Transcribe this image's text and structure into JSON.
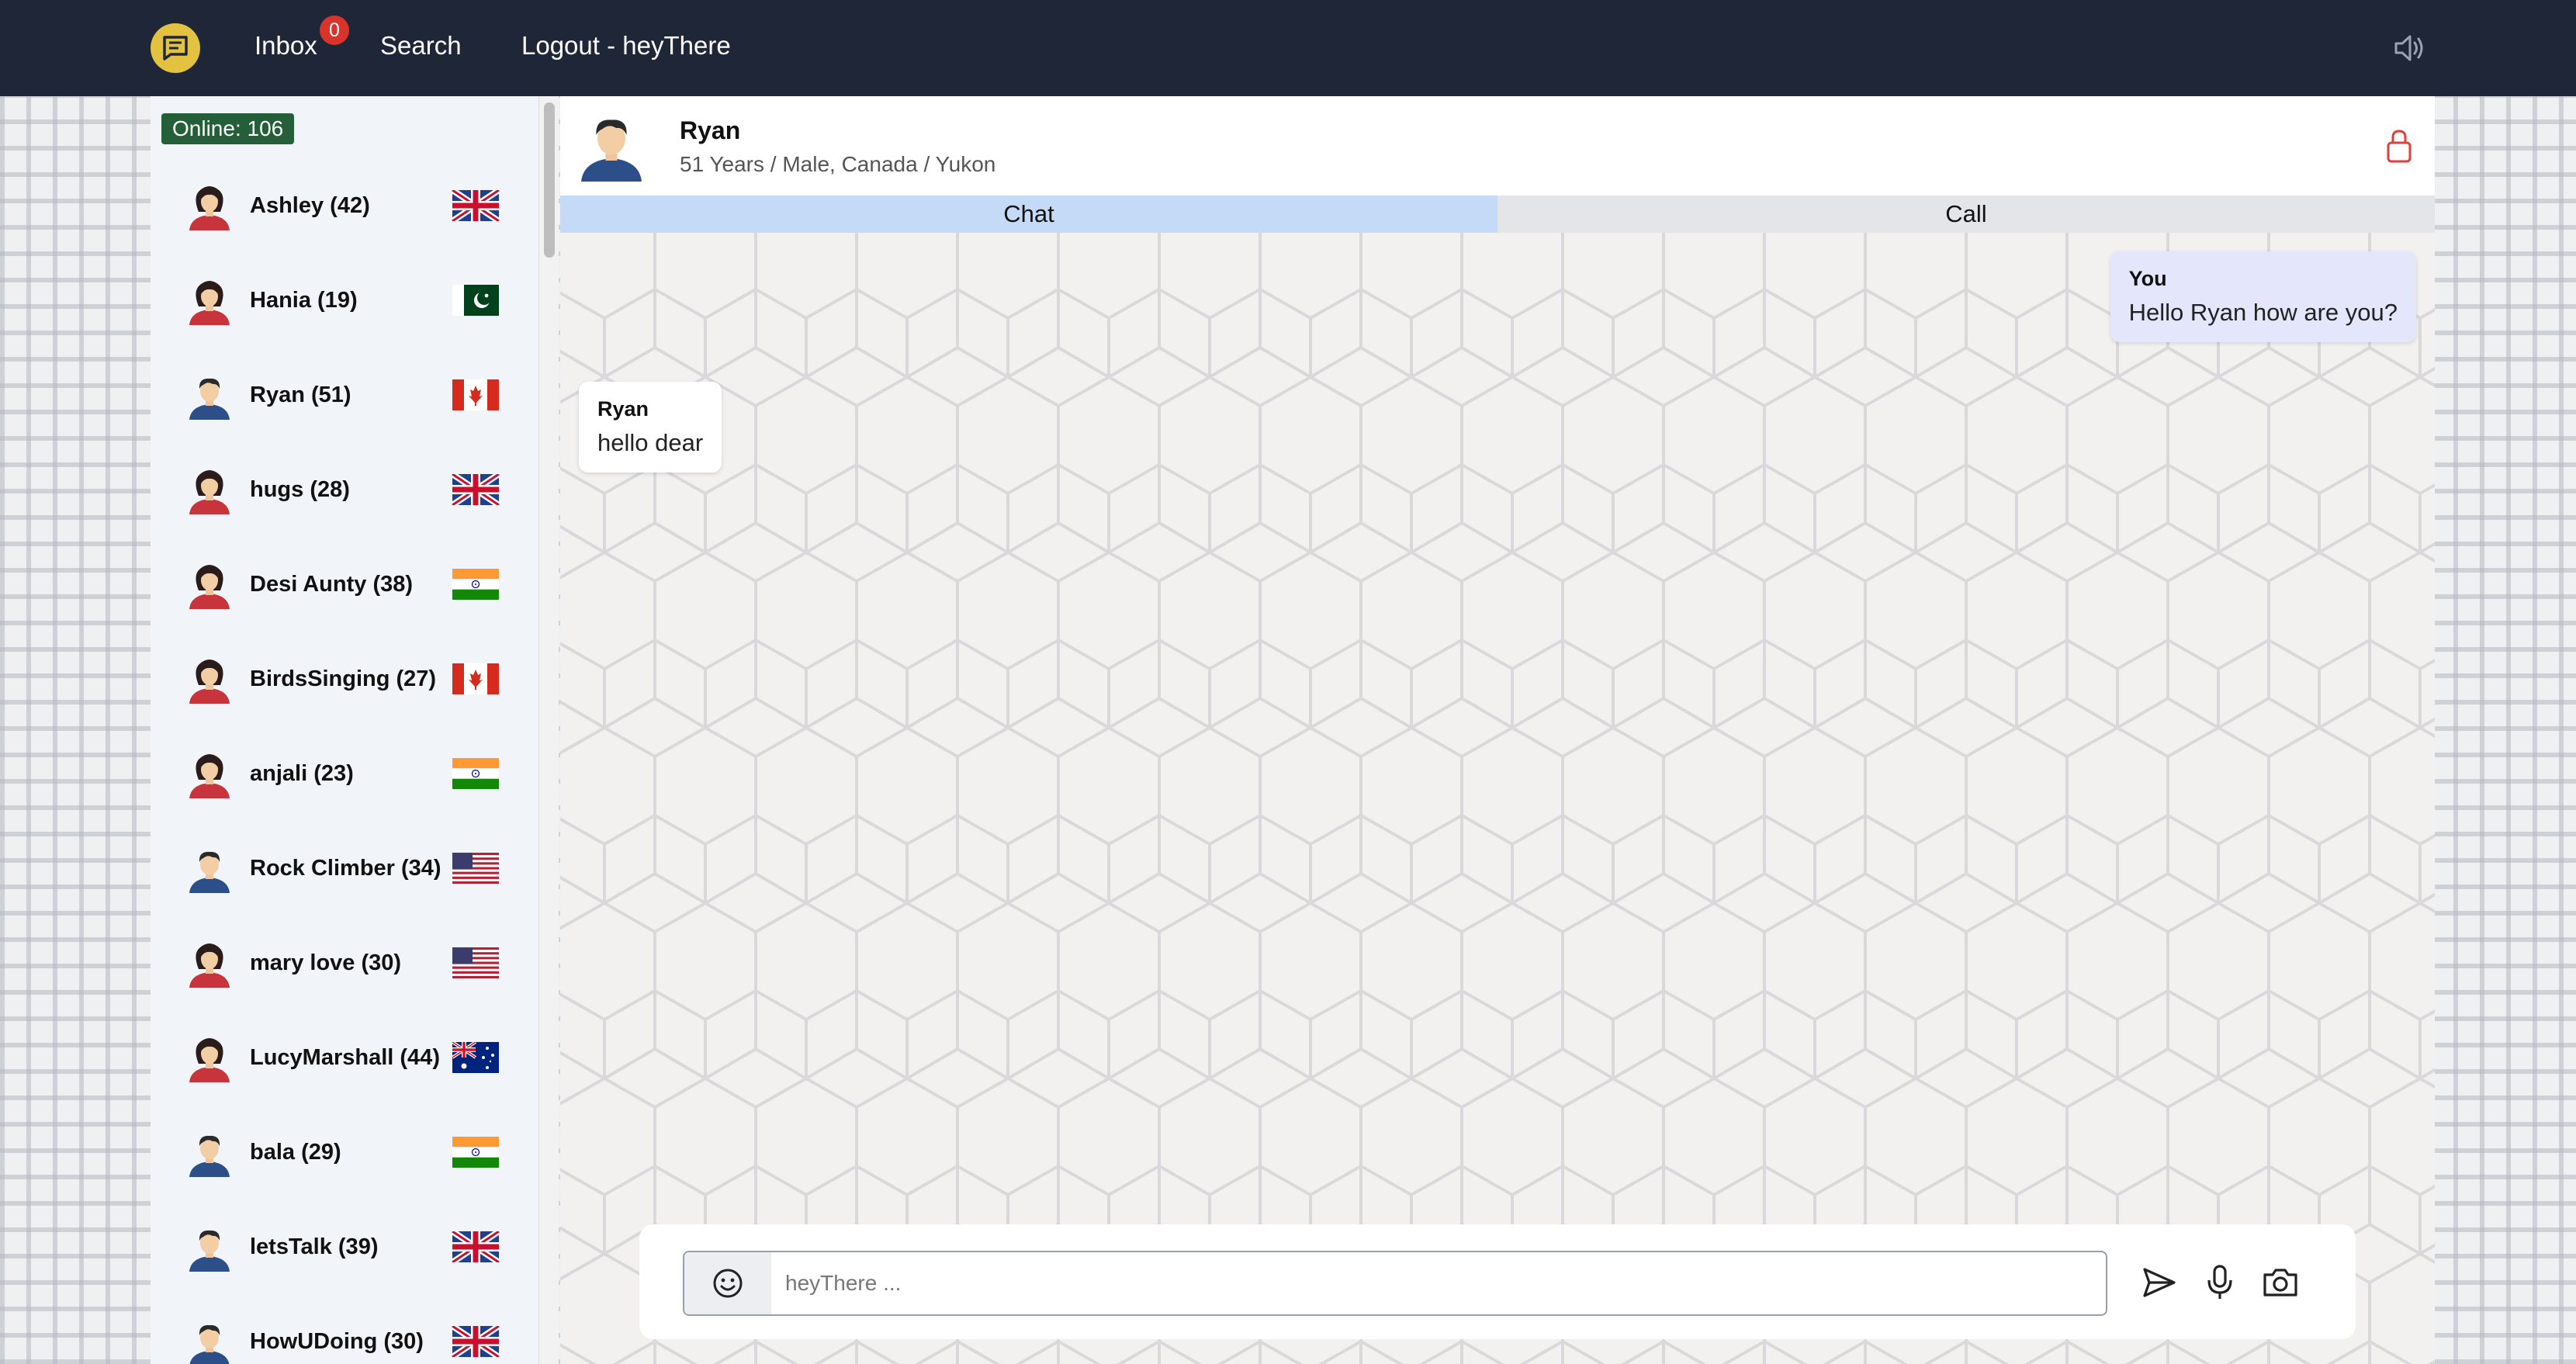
{
  "navbar": {
    "inbox_label": "Inbox",
    "inbox_count": "0",
    "search_label": "Search",
    "logout_label": "Logout - heyThere"
  },
  "sidebar": {
    "online_label": "Online: 106",
    "users": [
      {
        "name": "Ashley (42)",
        "gender": "female",
        "flag": "uk"
      },
      {
        "name": "Hania (19)",
        "gender": "female",
        "flag": "pakistan"
      },
      {
        "name": "Ryan (51)",
        "gender": "male",
        "flag": "canada"
      },
      {
        "name": "hugs (28)",
        "gender": "female",
        "flag": "uk"
      },
      {
        "name": "Desi Aunty (38)",
        "gender": "female",
        "flag": "india"
      },
      {
        "name": "BirdsSinging (27)",
        "gender": "female",
        "flag": "canada"
      },
      {
        "name": "anjali (23)",
        "gender": "female",
        "flag": "india"
      },
      {
        "name": "Rock Climber (34)",
        "gender": "male",
        "flag": "usa"
      },
      {
        "name": "mary love (30)",
        "gender": "female",
        "flag": "usa"
      },
      {
        "name": "LucyMarshall (44)",
        "gender": "female",
        "flag": "australia"
      },
      {
        "name": "bala (29)",
        "gender": "male",
        "flag": "india"
      },
      {
        "name": "letsTalk (39)",
        "gender": "male",
        "flag": "uk"
      },
      {
        "name": "HowUDoing (30)",
        "gender": "male",
        "flag": "uk"
      }
    ]
  },
  "chat": {
    "header": {
      "name": "Ryan",
      "details": "51 Years / Male, Canada / Yukon"
    },
    "tabs": {
      "chat_label": "Chat",
      "call_label": "Call"
    },
    "messages": [
      {
        "author": "You",
        "text": "Hello Ryan how are you?",
        "direction": "outgoing"
      },
      {
        "author": "Ryan",
        "text": "hello dear",
        "direction": "incoming"
      }
    ],
    "composer": {
      "placeholder": "heyThere ..."
    }
  },
  "colors": {
    "navbar_bg": "#1f2637",
    "logo": "#e3c23f",
    "badge": "#d8342c",
    "online_badge": "#245f3a",
    "active_tab": "#c5daf7",
    "lock": "#e0403a"
  }
}
